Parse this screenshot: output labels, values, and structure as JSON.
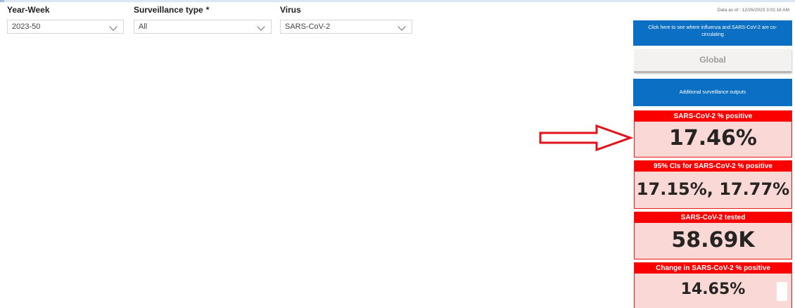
{
  "filters": {
    "year_week": {
      "label": "Year-Week",
      "value": "2023-50"
    },
    "surveillance_type": {
      "label": "Surveillance type",
      "required_mark": "*",
      "value": "All"
    },
    "virus": {
      "label": "Virus",
      "value": "SARS-CoV-2"
    }
  },
  "date_note": "Data as of : 12/26/2023 3:01:16 AM",
  "buttons": {
    "cocirculating": "Click here to see where influenza and SARS-CoV-2 are co-circulating",
    "global": "Global",
    "additional": "Additional surveillance outputs"
  },
  "cards": [
    {
      "title": "SARS-CoV-2 % positive",
      "value": "17.46%"
    },
    {
      "title": "95% CIs for SARS-CoV-2 % positive",
      "value": "17.15%, 17.77%"
    },
    {
      "title": "SARS-CoV-2 tested",
      "value": "58.69K"
    },
    {
      "title": "Change in SARS-CoV-2 % positive",
      "value": "14.65%"
    }
  ],
  "colors": {
    "accent_blue": "#0b6fc4",
    "card_red": "#fb0000",
    "card_bg": "#f9d8d6",
    "annotation_arrow": "#e0141a"
  },
  "icons": {
    "dropdown": "chevron-down-icon",
    "annotation": "right-arrow-icon"
  }
}
